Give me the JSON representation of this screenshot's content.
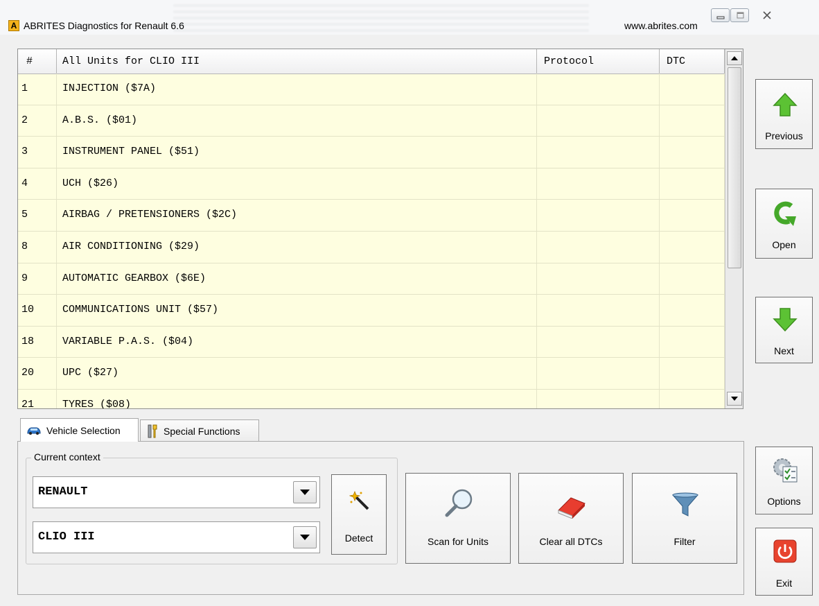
{
  "window": {
    "title": "ABRITES Diagnostics for Renault 6.6",
    "url": "www.abrites.com",
    "icon_letter": "A"
  },
  "table": {
    "headers": {
      "num": "#",
      "name": "All Units for CLIO III",
      "protocol": "Protocol",
      "dtc": "DTC"
    },
    "rows": [
      {
        "num": "1",
        "name": "INJECTION ($7A)",
        "protocol": "",
        "dtc": ""
      },
      {
        "num": "2",
        "name": "A.B.S. ($01)",
        "protocol": "",
        "dtc": ""
      },
      {
        "num": "3",
        "name": "INSTRUMENT PANEL ($51)",
        "protocol": "",
        "dtc": ""
      },
      {
        "num": "4",
        "name": "UCH ($26)",
        "protocol": "",
        "dtc": ""
      },
      {
        "num": "5",
        "name": "AIRBAG / PRETENSIONERS ($2C)",
        "protocol": "",
        "dtc": ""
      },
      {
        "num": "8",
        "name": "AIR CONDITIONING ($29)",
        "protocol": "",
        "dtc": ""
      },
      {
        "num": "9",
        "name": "AUTOMATIC GEARBOX ($6E)",
        "protocol": "",
        "dtc": ""
      },
      {
        "num": "10",
        "name": "COMMUNICATIONS UNIT ($57)",
        "protocol": "",
        "dtc": ""
      },
      {
        "num": "18",
        "name": "VARIABLE P.A.S. ($04)",
        "protocol": "",
        "dtc": ""
      },
      {
        "num": "20",
        "name": "UPC ($27)",
        "protocol": "",
        "dtc": ""
      },
      {
        "num": "21",
        "name": "TYRES ($08)",
        "protocol": "",
        "dtc": ""
      }
    ]
  },
  "side_buttons": {
    "previous": "Previous",
    "open": "Open",
    "next": "Next",
    "options": "Options",
    "exit": "Exit"
  },
  "tabs": {
    "vehicle_selection": "Vehicle Selection",
    "special_functions": "Special Functions"
  },
  "context": {
    "group_label": "Current context",
    "make": "RENAULT",
    "model": "CLIO III",
    "detect": "Detect"
  },
  "toolbar": {
    "scan": "Scan for Units",
    "clear": "Clear all DTCs",
    "filter": "Filter"
  },
  "icons": {
    "previous": "up-arrow-icon",
    "open": "open-arrow-icon",
    "next": "down-arrow-icon",
    "options": "gear-checklist-icon",
    "exit": "power-icon",
    "detect": "magic-wand-icon",
    "scan": "magnifier-icon",
    "clear": "eraser-icon",
    "filter": "funnel-icon",
    "vehicle_tab": "car-icon",
    "special_tab": "tools-icon"
  },
  "colors": {
    "table_bg": "#fefee0",
    "arrow_green": "#4caf2a",
    "exit_red": "#e8432e"
  }
}
